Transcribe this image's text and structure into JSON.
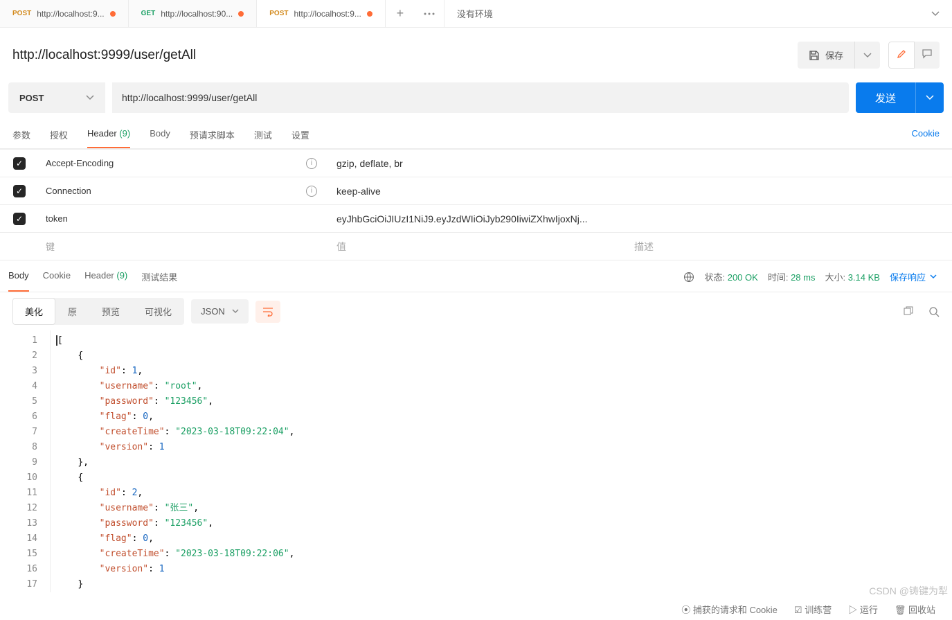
{
  "tabs": [
    {
      "method": "POST",
      "label": "http://localhost:9...",
      "dirty": true
    },
    {
      "method": "GET",
      "label": "http://localhost:90...",
      "dirty": true
    },
    {
      "method": "POST",
      "label": "http://localhost:9...",
      "dirty": true
    }
  ],
  "environment": {
    "label": "没有环境"
  },
  "title": "http://localhost:9999/user/getAll",
  "save_label": "保存",
  "request": {
    "method": "POST",
    "url": "http://localhost:9999/user/getAll",
    "send_label": "发送"
  },
  "request_tabs": {
    "params": "参数",
    "auth": "授权",
    "header_label": "Header",
    "header_count": "(9)",
    "body": "Body",
    "prerequest": "预请求脚本",
    "tests": "测试",
    "settings": "设置",
    "cookie": "Cookie"
  },
  "headers": [
    {
      "key": "Accept-Encoding",
      "value": "gzip, deflate, br",
      "info": true
    },
    {
      "key": "Connection",
      "value": "keep-alive",
      "info": true
    },
    {
      "key": "token",
      "value": "eyJhbGciOiJIUzI1NiJ9.eyJzdWIiOiJyb290IiwiZXhwIjoxNj...",
      "info": false
    }
  ],
  "header_placeholder": {
    "key": "键",
    "value": "值",
    "desc": "描述"
  },
  "response_tabs": {
    "body": "Body",
    "cookie": "Cookie",
    "header_label": "Header",
    "header_count": "(9)",
    "results": "测试结果"
  },
  "response_status": {
    "status_label": "状态:",
    "status_value": "200 OK",
    "time_label": "时间:",
    "time_value": "28 ms",
    "size_label": "大小:",
    "size_value": "3.14 KB",
    "save_label": "保存响应"
  },
  "view_tabs": {
    "pretty": "美化",
    "raw": "原",
    "preview": "预览",
    "visual": "可视化"
  },
  "format_label": "JSON",
  "response_body": [
    {
      "id": 1,
      "username": "root",
      "password": "123456",
      "flag": 0,
      "createTime": "2023-03-18T09:22:04",
      "version": 1
    },
    {
      "id": 2,
      "username": "张三",
      "password": "123456",
      "flag": 0,
      "createTime": "2023-03-18T09:22:06",
      "version": 1
    }
  ],
  "watermark": "CSDN @铸键为犁",
  "footer": {
    "capture": "捕获的请求和 Cookie",
    "bootcamp": "训练营",
    "runner": "运行",
    "trash": "回收站"
  }
}
